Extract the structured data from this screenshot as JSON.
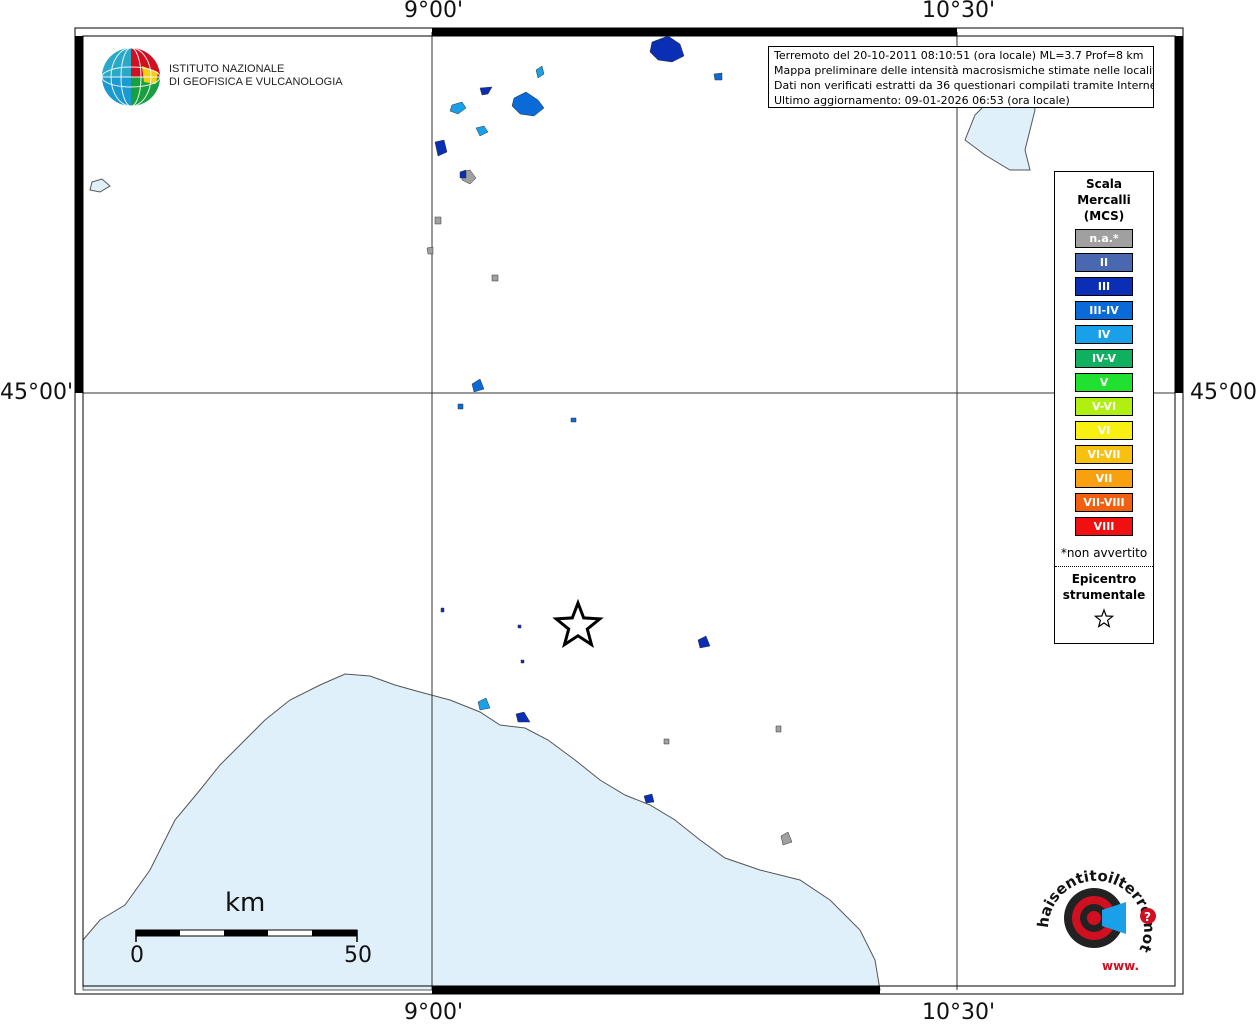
{
  "map": {
    "ticks": {
      "lon_left": "9°00'",
      "lon_right": "10°30'",
      "lat": "45°00'"
    },
    "info_lines": [
      "Terremoto del 20-10-2011 08:10:51 (ora locale) ML=3.7 Prof=8 km",
      "Mappa preliminare delle intensità macrosismiche stimate nelle località",
      "Dati non verificati estratti da 36 questionari compilati tramite Internet.",
      "Ultimo aggiornamento: 09-01-2026 06:53 (ora locale)"
    ],
    "institute": {
      "line1": "ISTITUTO NAZIONALE",
      "line2": "DI GEOFISICA E VULCANOLOGIA"
    },
    "legend": {
      "title_lines": [
        "Scala",
        "Mercalli",
        "(MCS)"
      ],
      "classes": [
        {
          "label": "n.a.*",
          "color": "#a0a0a0"
        },
        {
          "label": "II",
          "color": "#4a68b0"
        },
        {
          "label": "III",
          "color": "#0a2fb4"
        },
        {
          "label": "III-IV",
          "color": "#0a6ad8"
        },
        {
          "label": "IV",
          "color": "#1aa0e8"
        },
        {
          "label": "IV-V",
          "color": "#10b060"
        },
        {
          "label": "V",
          "color": "#20e030"
        },
        {
          "label": "V-VI",
          "color": "#b0f010"
        },
        {
          "label": "VI",
          "color": "#f8f010"
        },
        {
          "label": "VI-VII",
          "color": "#f8c010"
        },
        {
          "label": "VII",
          "color": "#f8a010"
        },
        {
          "label": "VII-VIII",
          "color": "#f06010"
        },
        {
          "label": "VIII",
          "color": "#f01010"
        }
      ],
      "note": "*non avvertito",
      "epicenter_lines": [
        "Epicentro",
        "strumentale"
      ]
    },
    "scale_bar": {
      "unit": "km",
      "min": "0",
      "max": "50"
    },
    "sea_color": "#dff0fb",
    "hst_logo": {
      "text": "haisentitoilterremoto.it",
      "prefix": "www."
    }
  }
}
